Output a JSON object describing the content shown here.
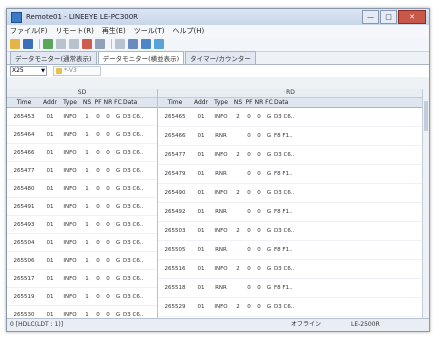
{
  "window": {
    "title": "Remote01 - LINEEYE LE-PC300R",
    "minimize": "—",
    "maximize": "□",
    "close": "✕"
  },
  "menu": [
    "ファイル(F)",
    "リモート(R)",
    "再生(E)",
    "ツール(T)",
    "ヘルプ(H)"
  ],
  "toolbar": [
    "open-icon",
    "save-icon",
    "play-icon",
    "stop-icon",
    "pause-icon",
    "record-icon",
    "print-icon",
    "search-icon",
    "config-icon",
    "monitor-icon",
    "info-icon"
  ],
  "tabs": [
    "データモニター(通常表示)",
    "データモニター(横並表示)",
    "タイマー/カウンター"
  ],
  "filter": {
    "select_value": "X25",
    "combo_value": "*-V3"
  },
  "panes": {
    "left_title": "SD",
    "right_title": "RD",
    "columns": [
      "Time",
      "Addr",
      "Type",
      "NS",
      "PF",
      "NR",
      "FC",
      "Data"
    ],
    "sd_rows": [
      [
        "265453",
        "01",
        "INFO",
        "1",
        "0",
        "0",
        "G",
        "D3 C6.."
      ],
      [
        "265464",
        "01",
        "INFO",
        "1",
        "0",
        "0",
        "G",
        "D3 C6.."
      ],
      [
        "265466",
        "01",
        "INFO",
        "1",
        "0",
        "0",
        "G",
        "D3 C6.."
      ],
      [
        "265477",
        "01",
        "INFO",
        "1",
        "0",
        "0",
        "G",
        "D3 C6.."
      ],
      [
        "265480",
        "01",
        "INFO",
        "1",
        "0",
        "0",
        "G",
        "D3 C6.."
      ],
      [
        "265491",
        "01",
        "INFO",
        "1",
        "0",
        "0",
        "G",
        "D3 C6.."
      ],
      [
        "265493",
        "01",
        "INFO",
        "1",
        "0",
        "0",
        "G",
        "D3 C6.."
      ],
      [
        "265504",
        "01",
        "INFO",
        "1",
        "0",
        "0",
        "G",
        "D3 C6.."
      ],
      [
        "265506",
        "01",
        "INFO",
        "1",
        "0",
        "0",
        "G",
        "D3 C6.."
      ],
      [
        "265517",
        "01",
        "INFO",
        "1",
        "0",
        "0",
        "G",
        "D3 C6.."
      ],
      [
        "265519",
        "01",
        "INFO",
        "1",
        "0",
        "0",
        "G",
        "D3 C6.."
      ],
      [
        "265530",
        "01",
        "INFO",
        "1",
        "0",
        "0",
        "G",
        "D3 C6.."
      ]
    ],
    "rd_rows": [
      [
        "265465",
        "01",
        "INFO",
        "2",
        "0",
        "0",
        "G",
        "D3 C6.."
      ],
      [
        "265466",
        "01",
        "RNR",
        "",
        "0",
        "0",
        "G",
        "F8 F1.."
      ],
      [
        "265477",
        "01",
        "INFO",
        "2",
        "0",
        "0",
        "G",
        "D3 C6.."
      ],
      [
        "265479",
        "01",
        "RNR",
        "",
        "0",
        "0",
        "G",
        "F8 F1.."
      ],
      [
        "265490",
        "01",
        "INFO",
        "2",
        "0",
        "0",
        "G",
        "D3 C6.."
      ],
      [
        "265492",
        "01",
        "RNR",
        "",
        "0",
        "0",
        "G",
        "F8 F1.."
      ],
      [
        "265503",
        "01",
        "INFO",
        "2",
        "0",
        "0",
        "G",
        "D3 C6.."
      ],
      [
        "265505",
        "01",
        "RNR",
        "",
        "0",
        "0",
        "G",
        "F8 F1.."
      ],
      [
        "265516",
        "01",
        "INFO",
        "2",
        "0",
        "0",
        "G",
        "D3 C6.."
      ],
      [
        "265518",
        "01",
        "RNR",
        "",
        "0",
        "0",
        "G",
        "F8 F1.."
      ],
      [
        "265529",
        "01",
        "INFO",
        "2",
        "0",
        "0",
        "G",
        "D3 C6.."
      ]
    ]
  },
  "status": {
    "left": "0 [HDLC(LDT : 1)]",
    "connection": "オフライン",
    "model": "LE-2500R"
  },
  "colors": {
    "close_button": "#c9584a",
    "accent": "#3a78c8"
  }
}
